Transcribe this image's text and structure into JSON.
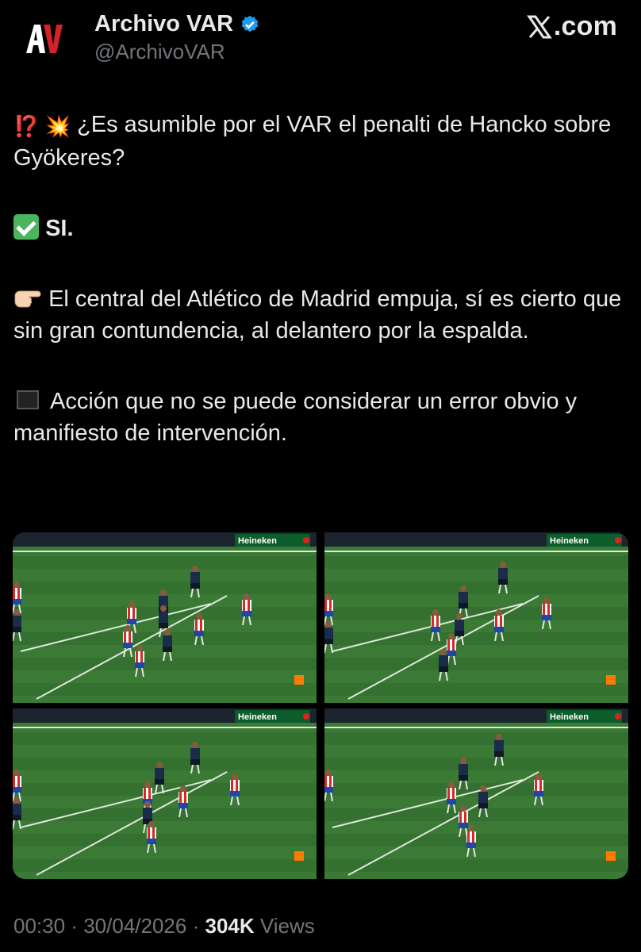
{
  "account": {
    "display_name": "Archivo VAR",
    "handle": "@ArchivoVAR",
    "avatar_icon": "archivo-var-logo",
    "verified_icon": "verified-badge-icon",
    "verified_color": "#1d9bf0"
  },
  "brand": {
    "site": ".com",
    "logo_icon": "x-logo-icon"
  },
  "tweet": {
    "p1_icons": "⁉️ 💥",
    "p1_text": "¿Es asumible por el VAR el penalti de Hancko sobre Gyökeres?",
    "p2_text": "SI.",
    "p3_text": "El central del Atlético de Madrid empuja, sí es cierto que sin gran contundencia, al delantero por la espalda.",
    "p4_text": "Acción que no se puede considerar un error obvio y manifiesto de intervención."
  },
  "media": {
    "frames": [
      {
        "sponsor": "Heineken",
        "label": "frame-1"
      },
      {
        "sponsor": "Heineken",
        "label": "frame-2"
      },
      {
        "sponsor": "Heineken",
        "label": "frame-3"
      },
      {
        "sponsor": "Heineken",
        "label": "frame-4"
      }
    ]
  },
  "meta": {
    "time": "00:30",
    "date": "30/04/2026",
    "views_count": "304K",
    "views_label": "Views",
    "separator": "·"
  }
}
